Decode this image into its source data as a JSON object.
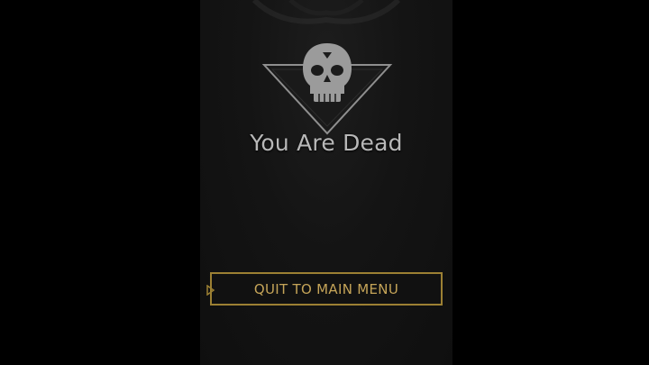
{
  "death_screen": {
    "title": "You Are Dead",
    "quit_button_label": "QUIT TO MAIN MENU"
  },
  "icons": {
    "emblem": "skull-triangle-icon",
    "selector": "selector-arrow-icon"
  },
  "colors": {
    "background": "#000000",
    "panel": "#141414",
    "title_text": "#b8b8b8",
    "button_border": "#9c8033",
    "button_text": "#c5a458"
  }
}
